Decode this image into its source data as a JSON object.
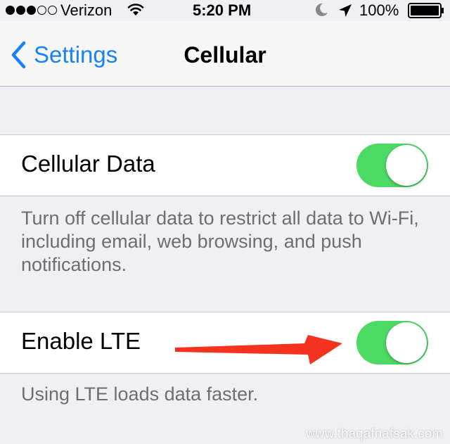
{
  "status_bar": {
    "signal_bars_filled": 3,
    "signal_bars_total": 5,
    "carrier": "Verizon",
    "time": "5:20 PM",
    "battery": "100%"
  },
  "nav": {
    "back_label": "Settings",
    "title": "Cellular"
  },
  "sections": [
    {
      "label": "Cellular Data",
      "toggle_on": true,
      "footer": "Turn off cellular data to restrict all data to Wi-Fi, including email, web browsing, and push notifications."
    },
    {
      "label": "Enable LTE",
      "toggle_on": true,
      "footer": "Using LTE loads data faster."
    }
  ],
  "watermark": "www.thaqafnafsak.com",
  "colors": {
    "accent": "#1a82f7",
    "toggle_on": "#4cd964",
    "annotation_arrow": "#f5321e",
    "background": "#efeff4"
  }
}
